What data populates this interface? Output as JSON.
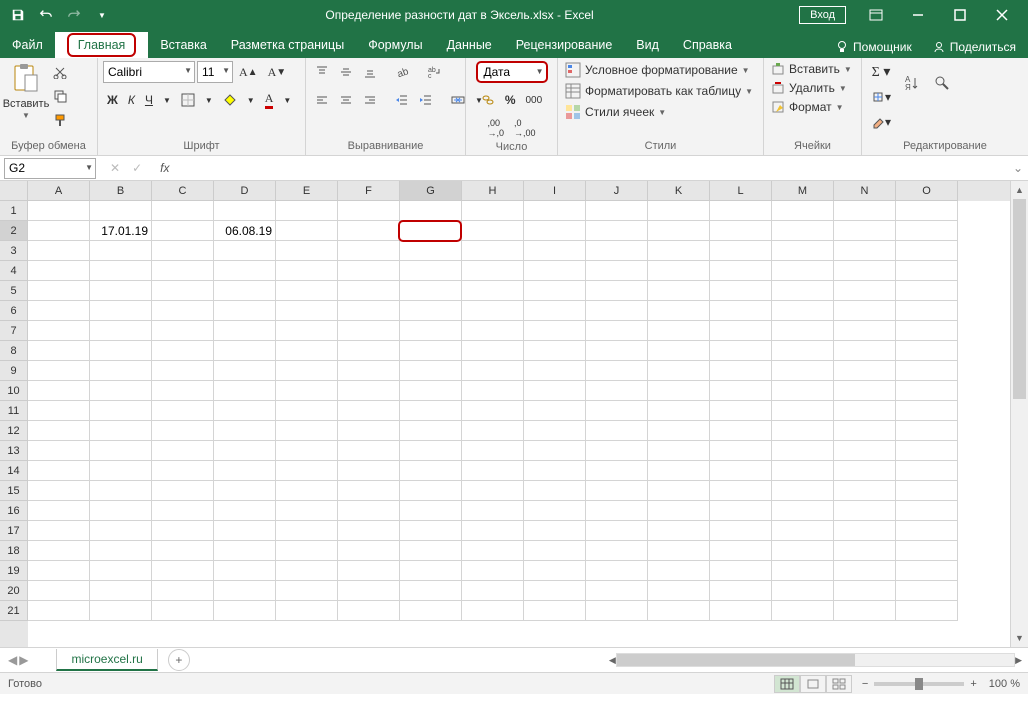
{
  "title": "Определение разности дат в Эксель.xlsx  -  Excel",
  "login_label": "Вход",
  "tabs": {
    "file": "Файл",
    "home": "Главная",
    "insert": "Вставка",
    "layout": "Разметка страницы",
    "formulas": "Формулы",
    "data": "Данные",
    "review": "Рецензирование",
    "view": "Вид",
    "help": "Справка",
    "tellme": "Помощник",
    "share": "Поделиться"
  },
  "ribbon": {
    "clipboard": {
      "paste": "Вставить",
      "group": "Буфер обмена"
    },
    "font": {
      "name": "Calibri",
      "size": "11",
      "group": "Шрифт",
      "bold": "Ж",
      "italic": "К",
      "underline": "Ч"
    },
    "alignment": {
      "group": "Выравнивание"
    },
    "number": {
      "format": "Дата",
      "group": "Число"
    },
    "styles": {
      "cond": "Условное форматирование",
      "table": "Форматировать как таблицу",
      "cell": "Стили ячеек",
      "group": "Стили"
    },
    "cells": {
      "insert": "Вставить",
      "delete": "Удалить",
      "format": "Формат",
      "group": "Ячейки"
    },
    "editing": {
      "group": "Редактирование"
    }
  },
  "name_box": "G2",
  "columns": [
    "A",
    "B",
    "C",
    "D",
    "E",
    "F",
    "G",
    "H",
    "I",
    "J",
    "K",
    "L",
    "M",
    "N",
    "O"
  ],
  "rows": 21,
  "cell_B2": "17.01.19",
  "cell_D2": "06.08.19",
  "sheet_name": "microexcel.ru",
  "status": "Готово",
  "zoom": "100 %"
}
